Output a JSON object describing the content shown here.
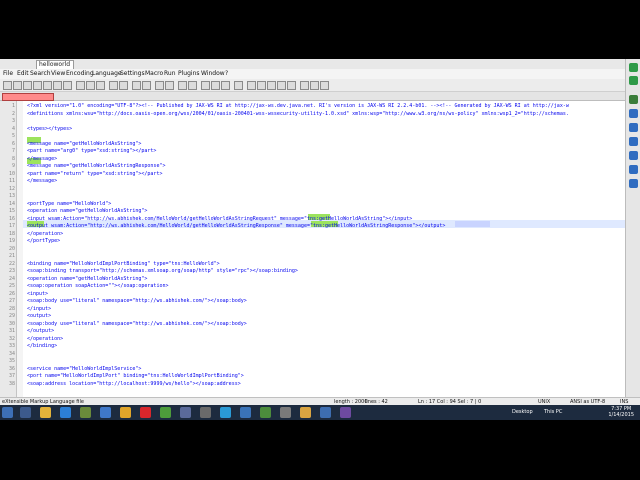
{
  "window": {
    "tab_label": "helloworld"
  },
  "menu": [
    "File",
    "Edit",
    "Search",
    "View",
    "Encoding",
    "Language",
    "Settings",
    "Macro",
    "Run",
    "Plugins",
    "Window",
    "?"
  ],
  "editor": {
    "lines": [
      {
        "n": "1",
        "t": "<?xml version=\"1.0\" encoding=\"UTF-8\"?><!-- Published by JAX-WS RI at http://jax-ws.dev.java.net. RI's version is JAX-WS RI 2.2.4-b01. --><!-- Generated by JAX-WS RI at http://jax-w"
      },
      {
        "n": "2",
        "t": "<definitions xmlns:wsu=\"http://docs.oasis-open.org/wss/2004/01/oasis-200401-wss-wssecurity-utility-1.0.xsd\" xmlns:wsp=\"http://www.w3.org/ns/ws-policy\" xmlns:wsp1_2=\"http://schemas."
      },
      {
        "n": "3",
        "t": ""
      },
      {
        "n": "4",
        "t": "<types></types>"
      },
      {
        "n": "5",
        "t": ""
      },
      {
        "n": "6",
        "t": "<message name=\"getHelloWorldAsString\">"
      },
      {
        "n": "7",
        "t": "<part name=\"arg0\" type=\"xsd:string\"></part>"
      },
      {
        "n": "8",
        "t": "</message>"
      },
      {
        "n": "9",
        "t": "<message name=\"getHelloWorldAsStringResponse\">"
      },
      {
        "n": "10",
        "t": "<part name=\"return\" type=\"xsd:string\"></part>"
      },
      {
        "n": "11",
        "t": "</message>"
      },
      {
        "n": "12",
        "t": ""
      },
      {
        "n": "13",
        "t": ""
      },
      {
        "n": "14",
        "t": "<portType name=\"HelloWorld\">"
      },
      {
        "n": "15",
        "t": "<operation name=\"getHelloWorldAsString\">"
      },
      {
        "n": "16",
        "t": "<input wsam:Action=\"http://ws.abhishek.com/HelloWorld/getHelloWorldAsStringRequest\" message=\"tns:getHelloWorldAsString\"></input>"
      },
      {
        "n": "17",
        "t": "<output wsam:Action=\"http://ws.abhishek.com/HelloWorld/getHelloWorldAsStringResponse\" message=\"tns:getHelloWorldAsStringResponse\"></output>"
      },
      {
        "n": "18",
        "t": "</operation>"
      },
      {
        "n": "19",
        "t": "</portType>"
      },
      {
        "n": "20",
        "t": ""
      },
      {
        "n": "21",
        "t": ""
      },
      {
        "n": "22",
        "t": "<binding name=\"HelloWorldImplPortBinding\" type=\"tns:HelloWorld\">"
      },
      {
        "n": "23",
        "t": "<soap:binding transport=\"http://schemas.xmlsoap.org/soap/http\" style=\"rpc\"></soap:binding>"
      },
      {
        "n": "24",
        "t": "<operation name=\"getHelloWorldAsString\">"
      },
      {
        "n": "25",
        "t": "<soap:operation soapAction=\"\"></soap:operation>"
      },
      {
        "n": "26",
        "t": "<input>"
      },
      {
        "n": "27",
        "t": "<soap:body use=\"literal\" namespace=\"http://ws.abhishek.com/\"></soap:body>"
      },
      {
        "n": "28",
        "t": "</input>"
      },
      {
        "n": "29",
        "t": "<output>"
      },
      {
        "n": "30",
        "t": "<soap:body use=\"literal\" namespace=\"http://ws.abhishek.com/\"></soap:body>"
      },
      {
        "n": "31",
        "t": "</output>"
      },
      {
        "n": "32",
        "t": "</operation>"
      },
      {
        "n": "33",
        "t": "</binding>"
      },
      {
        "n": "34",
        "t": ""
      },
      {
        "n": "35",
        "t": ""
      },
      {
        "n": "36",
        "t": "<service name=\"HelloWorldImplService\">"
      },
      {
        "n": "37",
        "t": "<port name=\"HelloWorldImplPort\" binding=\"tns:HelloWorldImplPortBinding\">"
      },
      {
        "n": "38",
        "t": "<soap:address location=\"http://localhost:9999/ws/hello\"></soap:address>"
      }
    ]
  },
  "status": {
    "file_type": "eXtensible Markup Language file",
    "length": "length : 2000",
    "lines": "lines : 42",
    "position": "Ln : 17    Col : 94    Sel : 7 | 0",
    "eol": "UNIX",
    "encoding": "ANSI as UTF-8",
    "mode": "INS"
  },
  "taskbar": {
    "desktop": "Desktop",
    "thispc": "This PC",
    "time": "7:37 PM",
    "date": "1/14/2015"
  },
  "colors": {
    "taskbar": "#1d2b3f",
    "tag_green": "#9ce35d",
    "current_line": "#dfe9ff"
  }
}
